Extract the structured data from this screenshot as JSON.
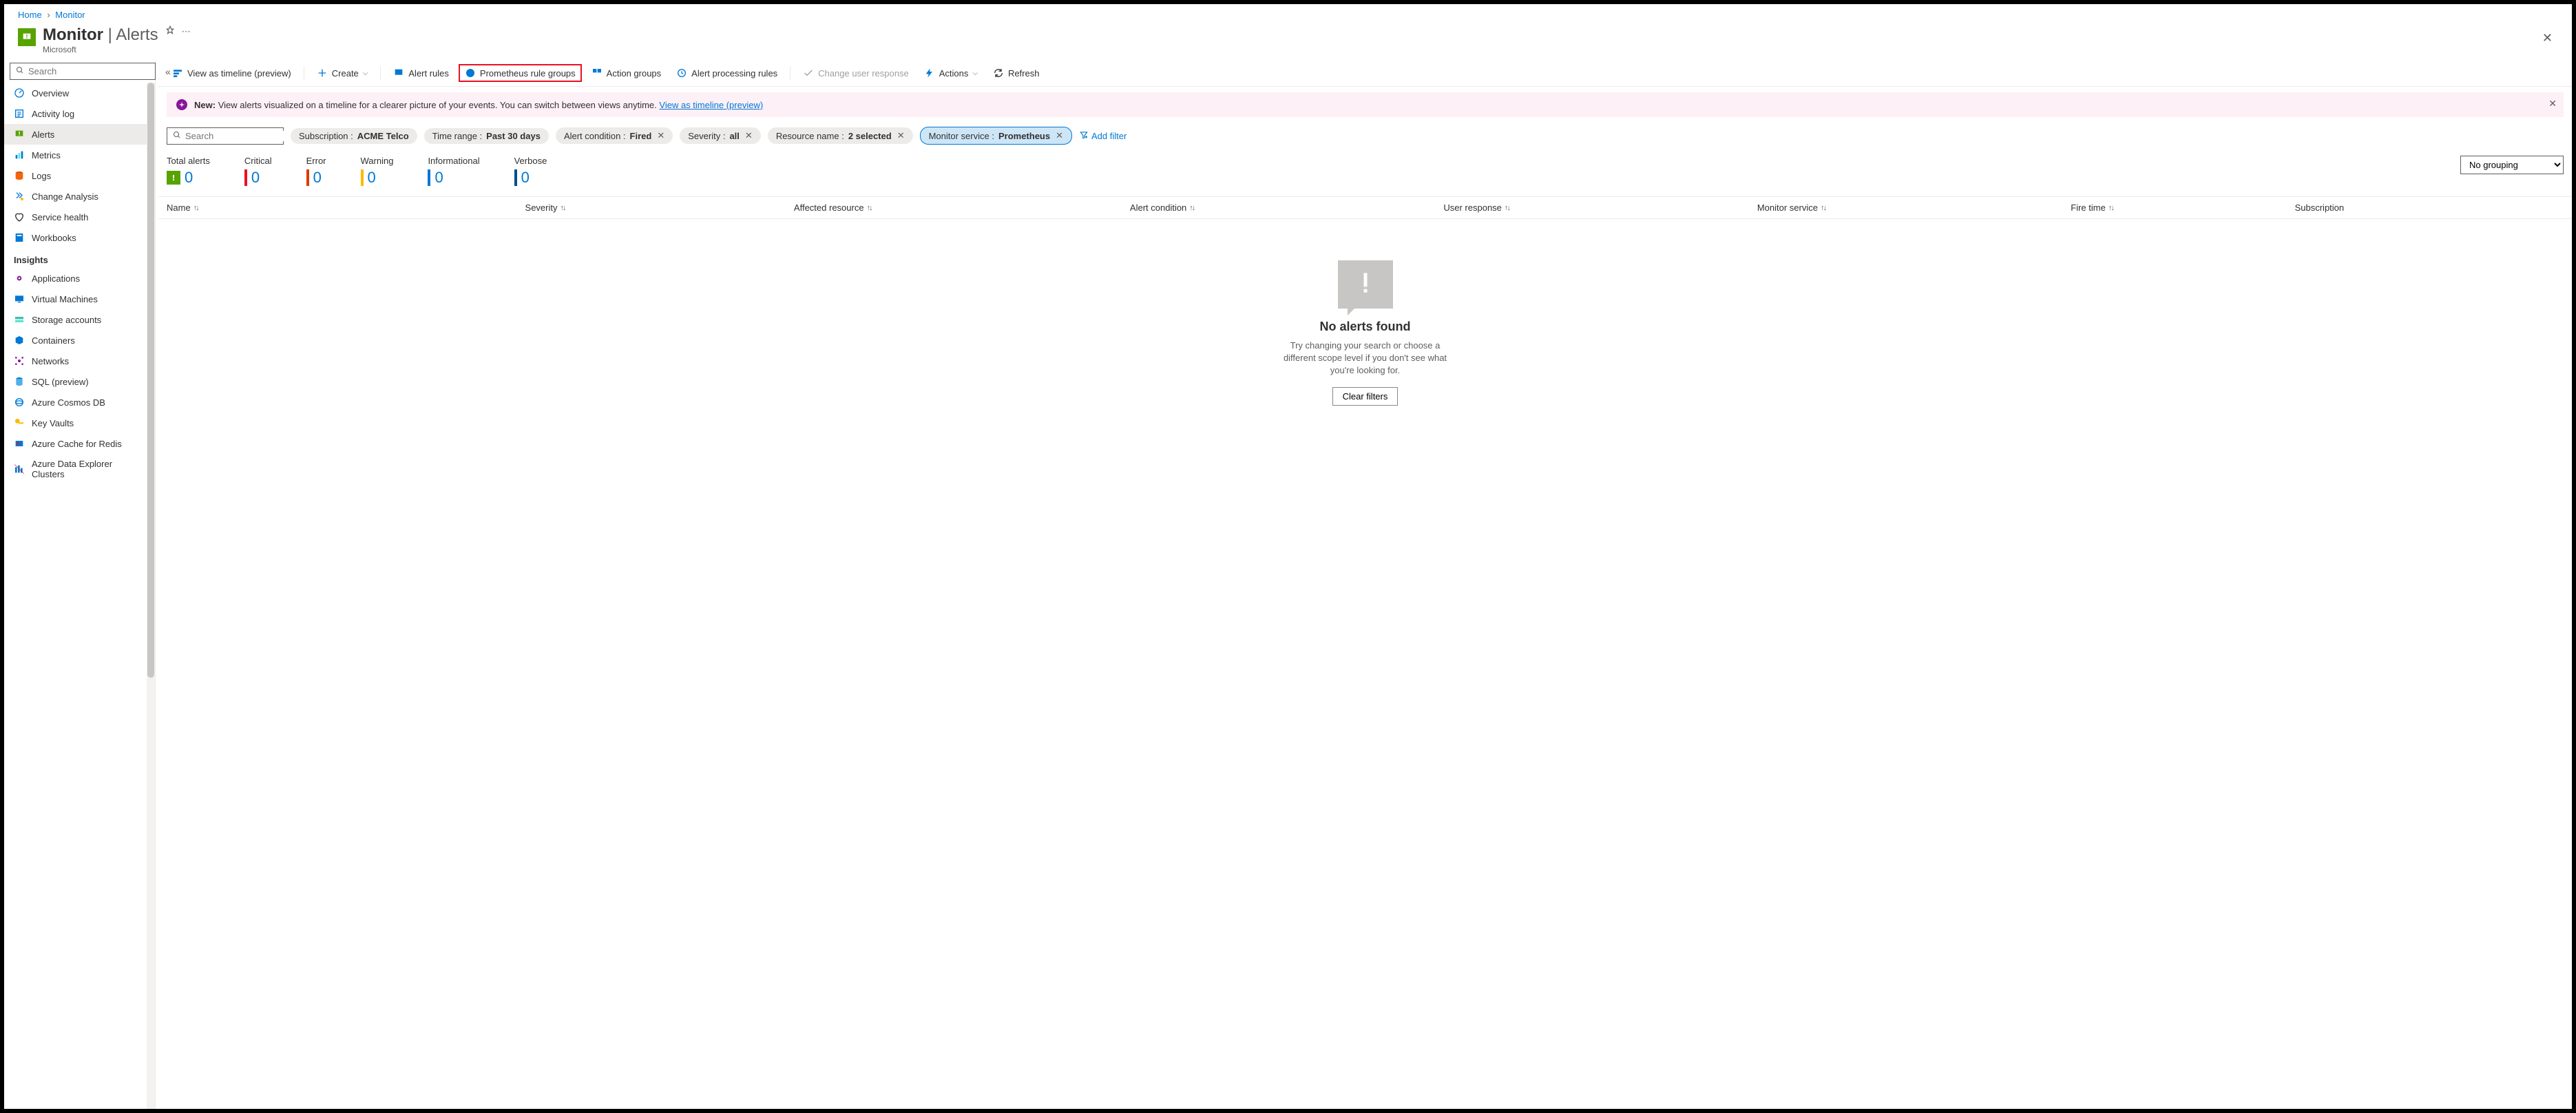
{
  "breadcrumb": {
    "home": "Home",
    "monitor": "Monitor"
  },
  "header": {
    "title": "Monitor",
    "subtitle": "Alerts",
    "company": "Microsoft"
  },
  "sidebar": {
    "search_placeholder": "Search",
    "items": [
      {
        "label": "Overview",
        "icon": "gauge"
      },
      {
        "label": "Activity log",
        "icon": "log"
      },
      {
        "label": "Alerts",
        "icon": "alert",
        "active": true
      },
      {
        "label": "Metrics",
        "icon": "metrics"
      },
      {
        "label": "Logs",
        "icon": "logs"
      },
      {
        "label": "Change Analysis",
        "icon": "change"
      },
      {
        "label": "Service health",
        "icon": "heart"
      },
      {
        "label": "Workbooks",
        "icon": "workbook"
      }
    ],
    "section": "Insights",
    "insights": [
      {
        "label": "Applications",
        "icon": "app"
      },
      {
        "label": "Virtual Machines",
        "icon": "vm"
      },
      {
        "label": "Storage accounts",
        "icon": "storage"
      },
      {
        "label": "Containers",
        "icon": "container"
      },
      {
        "label": "Networks",
        "icon": "network"
      },
      {
        "label": "SQL (preview)",
        "icon": "sql"
      },
      {
        "label": "Azure Cosmos DB",
        "icon": "cosmos"
      },
      {
        "label": "Key Vaults",
        "icon": "key"
      },
      {
        "label": "Azure Cache for Redis",
        "icon": "redis"
      },
      {
        "label": "Azure Data Explorer Clusters",
        "icon": "adx"
      }
    ]
  },
  "toolbar": {
    "timeline": "View as timeline (preview)",
    "create": "Create",
    "alert_rules": "Alert rules",
    "prometheus": "Prometheus rule groups",
    "action_groups": "Action groups",
    "processing": "Alert processing rules",
    "change_response": "Change user response",
    "actions": "Actions",
    "refresh": "Refresh"
  },
  "banner": {
    "prefix": "New:",
    "text": "View alerts visualized on a timeline for a clearer picture of your events. You can switch between views anytime.",
    "link": "View as timeline (preview)"
  },
  "filters": {
    "search_placeholder": "Search",
    "pills": [
      {
        "label": "Subscription :",
        "value": "ACME Telco",
        "close": false
      },
      {
        "label": "Time range :",
        "value": "Past 30 days",
        "close": false
      },
      {
        "label": "Alert condition :",
        "value": "Fired",
        "close": true
      },
      {
        "label": "Severity :",
        "value": "all",
        "close": true
      },
      {
        "label": "Resource name :",
        "value": "2 selected",
        "close": true
      },
      {
        "label": "Monitor service :",
        "value": "Prometheus",
        "close": true,
        "selected": true
      }
    ],
    "add_filter": "Add filter"
  },
  "stats": [
    {
      "label": "Total alerts",
      "value": "0",
      "color": "#57a300",
      "type": "icon"
    },
    {
      "label": "Critical",
      "value": "0",
      "color": "#e81123",
      "type": "bar"
    },
    {
      "label": "Error",
      "value": "0",
      "color": "#da3b01",
      "type": "bar"
    },
    {
      "label": "Warning",
      "value": "0",
      "color": "#ffb900",
      "type": "bar"
    },
    {
      "label": "Informational",
      "value": "0",
      "color": "#0078d4",
      "type": "bar"
    },
    {
      "label": "Verbose",
      "value": "0",
      "color": "#004e8c",
      "type": "bar"
    }
  ],
  "grouping": {
    "value": "No grouping"
  },
  "columns": [
    "Name",
    "Severity",
    "Affected resource",
    "Alert condition",
    "User response",
    "Monitor service",
    "Fire time",
    "Subscription"
  ],
  "empty": {
    "title": "No alerts found",
    "msg": "Try changing your search or choose a different scope level if you don't see what you're looking for.",
    "button": "Clear filters"
  }
}
